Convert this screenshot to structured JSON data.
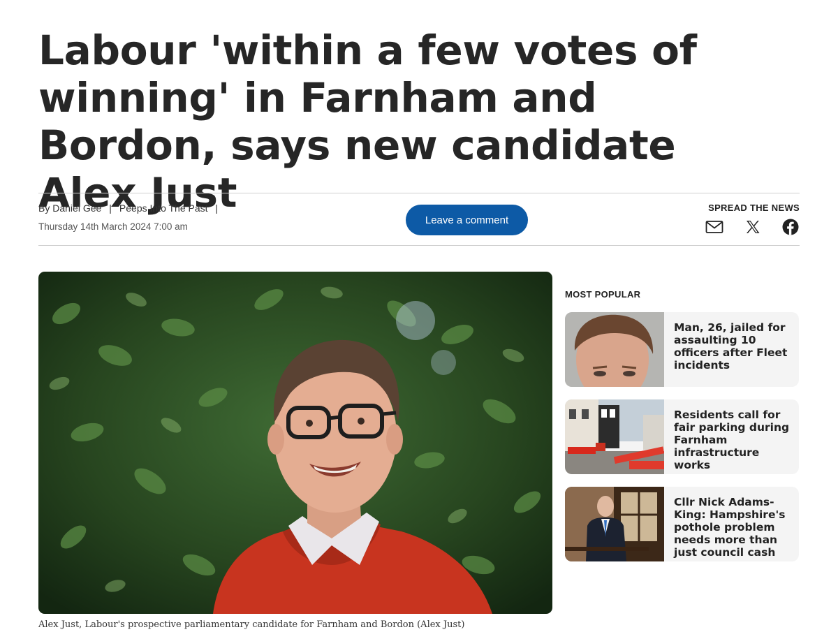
{
  "article": {
    "headline": "Labour 'within a few votes of winning' in Farnham and Bordon, says new candidate Alex Just",
    "byline_prefix": "By",
    "author": "Daniel Gee",
    "section": "Peeps Into The Past",
    "date": "Thursday 14th March 2024 7:00 am",
    "caption": "Alex Just, Labour's prospective parliamentary candidate for Farnham and Bordon (Alex Just)"
  },
  "actions": {
    "comment_label": "Leave a comment",
    "spread_title": "SPREAD THE NEWS",
    "share_icons": [
      "email-icon",
      "x-icon",
      "facebook-icon"
    ]
  },
  "sidebar": {
    "title": "MOST POPULAR",
    "items": [
      {
        "headline": "Man, 26, jailed for assaulting 10 officers after Fleet incidents"
      },
      {
        "headline": "Residents call for fair parking during Farnham infrastructure works"
      },
      {
        "headline": "Cllr Nick Adams-King: Hampshire's pothole problem needs more than just council cash"
      }
    ]
  },
  "colors": {
    "accent": "#0d5aa6",
    "card_bg": "#f4f4f4",
    "rule": "#cfcfcf"
  }
}
